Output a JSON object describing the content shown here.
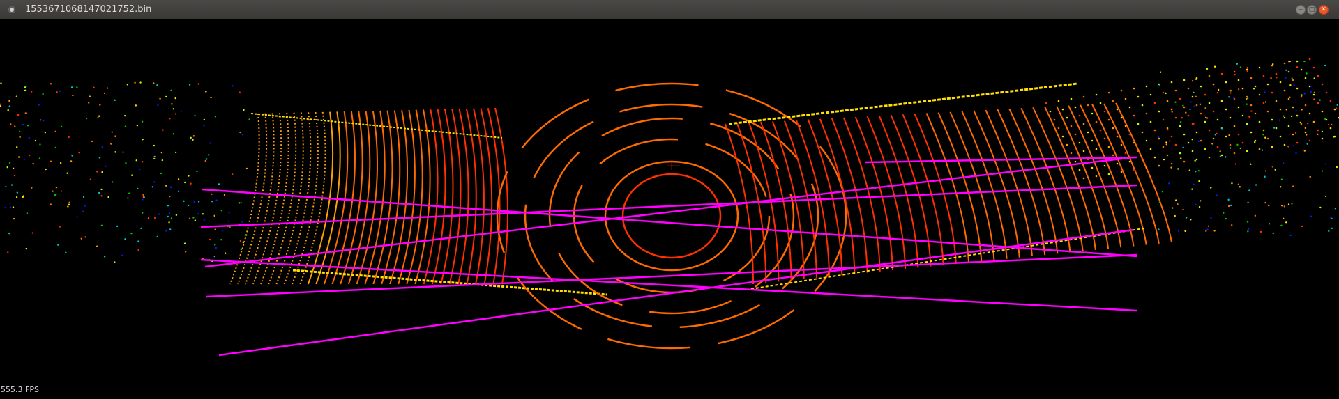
{
  "window": {
    "title": "1553671068147021752.bin",
    "buttons": [
      "minimize",
      "maximize",
      "close"
    ]
  },
  "viewer": {
    "fps_label": "555.3 FPS",
    "background_color": "#000000",
    "overlay_line_color": "#ff00ff",
    "point_colors": [
      "#ff3000",
      "#ff6a00",
      "#ffa000",
      "#ffe000",
      "#c8ff00",
      "#00c800",
      "#00c8c8",
      "#0020ff"
    ]
  }
}
